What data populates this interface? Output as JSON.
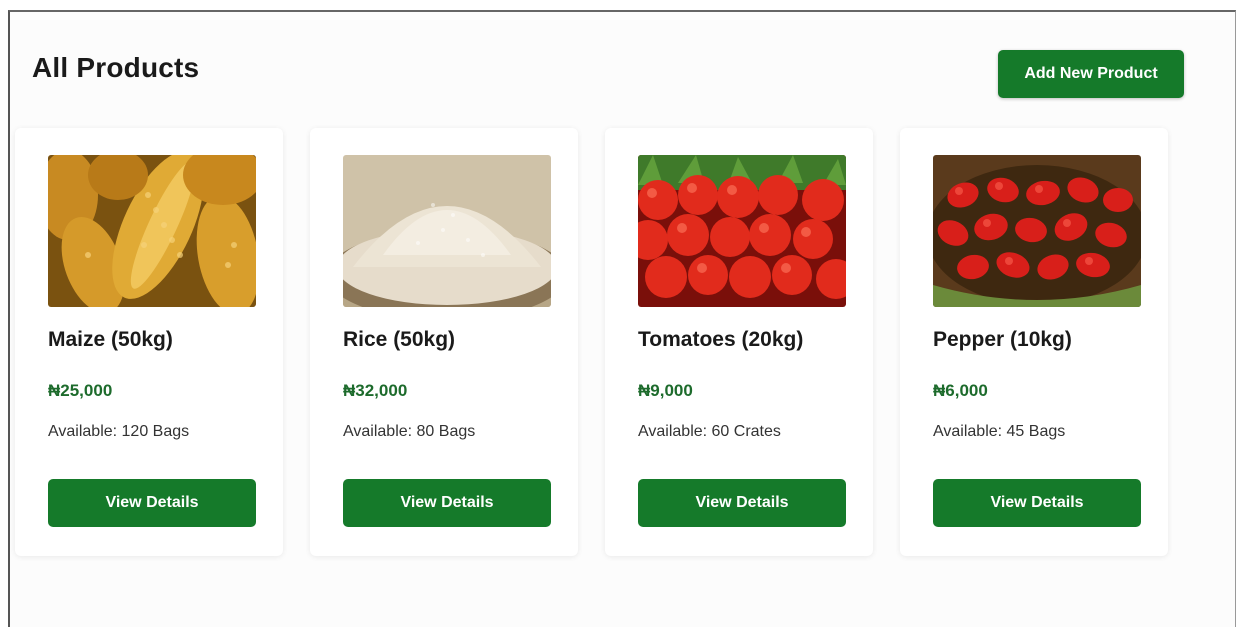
{
  "header": {
    "title": "All Products",
    "add_button_label": "Add New Product"
  },
  "products": [
    {
      "name": "Maize (50kg)",
      "price": "₦25,000",
      "availability": "Available: 120 Bags",
      "button_label": "View Details",
      "image_icon": "maize-image"
    },
    {
      "name": "Rice (50kg)",
      "price": "₦32,000",
      "availability": "Available: 80 Bags",
      "button_label": "View Details",
      "image_icon": "rice-image"
    },
    {
      "name": "Tomatoes (20kg)",
      "price": "₦9,000",
      "availability": "Available: 60 Crates",
      "button_label": "View Details",
      "image_icon": "tomatoes-image"
    },
    {
      "name": "Pepper (10kg)",
      "price": "₦6,000",
      "availability": "Available: 45 Bags",
      "button_label": "View Details",
      "image_icon": "pepper-image"
    }
  ],
  "colors": {
    "primary_green": "#157a2a",
    "price_green": "#1d6b2c"
  }
}
